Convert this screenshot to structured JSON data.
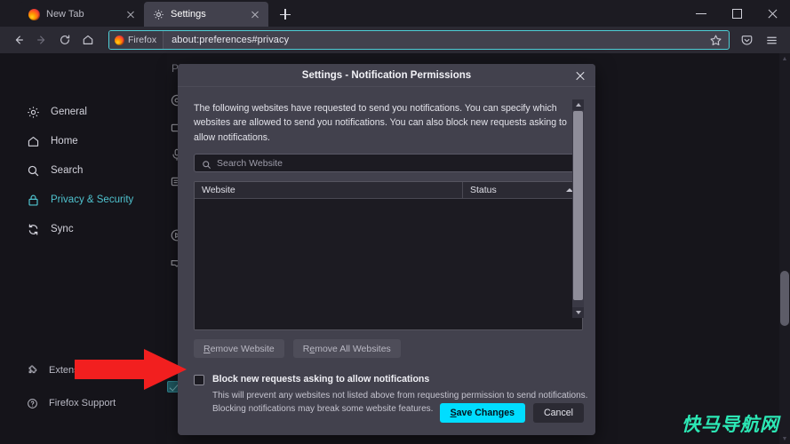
{
  "window": {
    "controls": [
      {
        "name": "minimize",
        "icon": "minimize-icon"
      },
      {
        "name": "maximize",
        "icon": "maximize-icon"
      },
      {
        "name": "close",
        "icon": "close-icon"
      }
    ]
  },
  "tabs": [
    {
      "title": "New Tab",
      "icon": "firefox-logo-icon",
      "active": false
    },
    {
      "title": "Settings",
      "icon": "gear-icon",
      "active": true
    }
  ],
  "newtab_label": "+",
  "nav": {
    "back_icon": "back-arrow-icon",
    "forward_icon": "forward-arrow-icon",
    "reload_icon": "reload-icon",
    "home_icon": "home-icon",
    "identity_label": "Firefox",
    "url": "about:preferences#privacy",
    "bookmark_icon": "star-icon",
    "pocket_icon": "pocket-icon",
    "menu_icon": "hamburger-menu-icon"
  },
  "sidebar": {
    "items": [
      {
        "label": "General",
        "icon": "gear-icon",
        "selected": false
      },
      {
        "label": "Home",
        "icon": "home-icon",
        "selected": false
      },
      {
        "label": "Search",
        "icon": "search-icon",
        "selected": false
      },
      {
        "label": "Privacy & Security",
        "icon": "lock-icon",
        "selected": true
      },
      {
        "label": "Sync",
        "icon": "sync-icon",
        "selected": false
      }
    ],
    "bottom_items": [
      {
        "label": "Extensions & Themes",
        "icon": "puzzle-icon"
      },
      {
        "label": "Firefox Support",
        "icon": "question-circle-icon"
      }
    ]
  },
  "background": {
    "section_heading": "Pe",
    "icons": [
      "location-icon",
      "camera-icon",
      "microphone-icon",
      "notification-icon",
      "autoplay-icon",
      "vr-icon"
    ]
  },
  "dialog": {
    "title": "Settings - Notification Permissions",
    "close_icon": "close-icon",
    "description": "The following websites have requested to send you notifications. You can specify which websites are allowed to send you notifications. You can also block new requests asking to allow notifications.",
    "search": {
      "placeholder": "Search Website",
      "icon": "search-icon",
      "value": ""
    },
    "table": {
      "columns": [
        "Website",
        "Status"
      ],
      "sort_icon": "sort-ascending-icon",
      "rows": []
    },
    "buttons": {
      "remove_website": "Remove Website",
      "remove_website_accesskey": "R",
      "remove_all": "Remove All Websites",
      "remove_all_accesskey": "e"
    },
    "block_checkbox": {
      "label": "Block new requests asking to allow notifications",
      "checked": false
    },
    "block_note": "This will prevent any websites not listed above from requesting permission to send notifications. Blocking notifications may break some website features.",
    "actions": {
      "save": "Save Changes",
      "save_accesskey": "S",
      "cancel": "Cancel"
    }
  },
  "annotation": {
    "arrow_color": "#f21f1f",
    "points_to": "block-new-requests-checkbox"
  },
  "watermark": "快马导航网",
  "colors": {
    "accent": "#00ddff",
    "selected_sidebar": "#4fc3cf",
    "dialog_bg": "#42414d",
    "chrome_bg": "#2b2a33",
    "page_bg": "#1c1b22",
    "arrow_red": "#f21f1f",
    "watermark_green": "#2ce8b5"
  }
}
